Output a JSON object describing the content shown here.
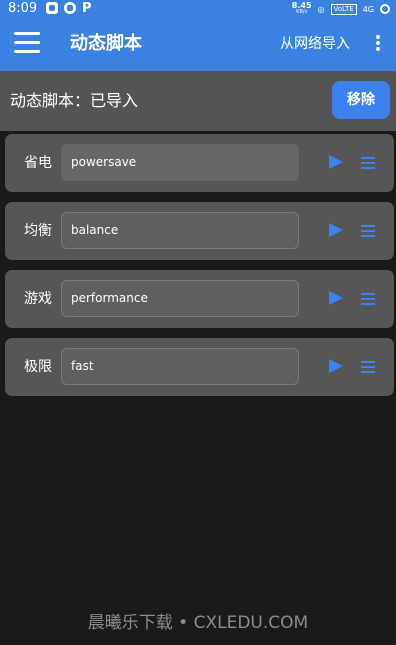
{
  "status_bar": {
    "time": "8:09",
    "left_icons": [
      "gallery-icon",
      "cloud-icon",
      "p-icon"
    ],
    "p_icon_text": "P",
    "network_speed": "8.45",
    "network_speed_unit": "KB/s",
    "volte": "VoLTE",
    "signal": "4G"
  },
  "app_bar": {
    "title": "动态脚本",
    "import_label": "从网络导入"
  },
  "header": {
    "status_text": "动态脚本：已导入",
    "remove_label": "移除"
  },
  "modes": [
    {
      "label": "省电",
      "value": "powersave"
    },
    {
      "label": "均衡",
      "value": "balance"
    },
    {
      "label": "游戏",
      "value": "performance"
    },
    {
      "label": "极限",
      "value": "fast"
    }
  ],
  "watermark": "晨曦乐下载 • CXLEDU.COM",
  "colors": {
    "accent": "#3b82e0",
    "header_bg": "#535453",
    "card_bg": "#555655",
    "page_bg": "#1a1a1a"
  }
}
